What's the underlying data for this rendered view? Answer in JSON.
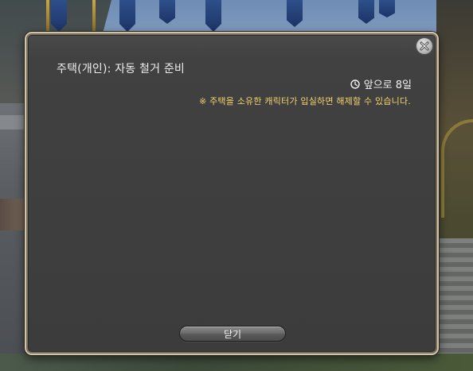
{
  "dialog": {
    "title": "주택(개인): 자동 철거 준비",
    "time_remaining": "앞으로 8일",
    "notice": "※ 주택을 소유한 캐릭터가 입실하면 해제할 수 있습니다.",
    "close_label": "닫기",
    "notice_color": "#f3d36e"
  },
  "icons": {
    "clock": "clock-icon",
    "close": "close-x-icon"
  }
}
